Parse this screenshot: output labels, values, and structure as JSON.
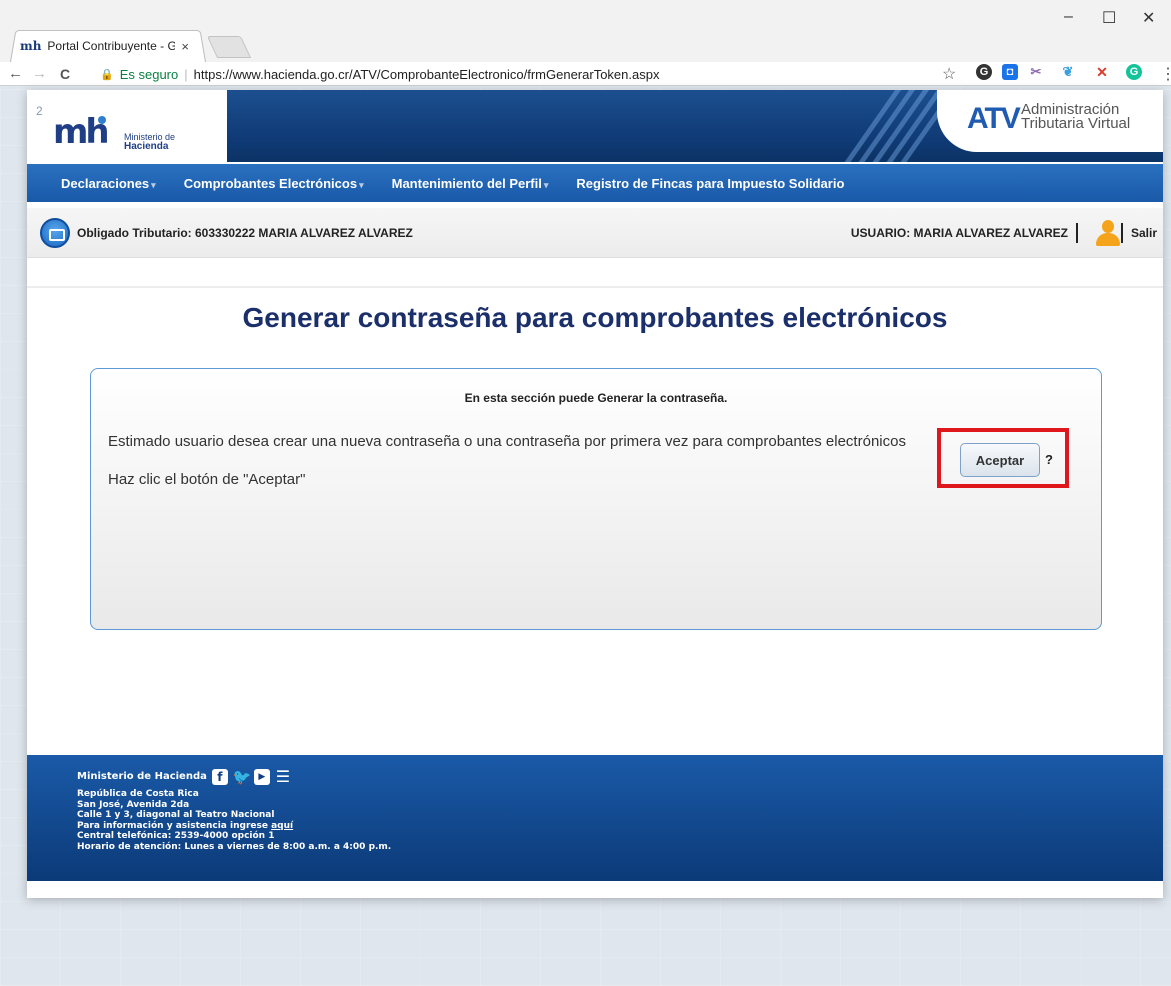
{
  "browser": {
    "tab_favicon": "mh",
    "tab_title": "Portal Contribuyente - Gi",
    "tab_close": "×",
    "secure_label": "Es seguro",
    "url": "https://www.hacienda.go.cr/ATV/ComprobanteElectronico/frmGenerarToken.aspx",
    "window_controls": {
      "minimize": "–",
      "maximize": "☐",
      "close": "✕"
    },
    "nav": {
      "back": "←",
      "forward": "→",
      "reload": "C"
    },
    "star": "☆",
    "more": "⋮",
    "extensions": [
      {
        "icon": "extension-g-icon",
        "glyph": "G",
        "color": "#333333"
      },
      {
        "icon": "extension-square-icon",
        "glyph": "◘",
        "color": "#1a73e8"
      },
      {
        "icon": "extension-scissors-icon",
        "glyph": "✂",
        "color": "#8c6bb1"
      },
      {
        "icon": "extension-leaf-icon",
        "glyph": "❦",
        "color": "#3aa0e0"
      },
      {
        "icon": "extension-x-icon",
        "glyph": "✕",
        "color": "#d93b2b"
      },
      {
        "icon": "extension-grammarly-icon",
        "glyph": "G",
        "color": "#15c39a"
      }
    ]
  },
  "header": {
    "corner_number": "2",
    "logo_mh": "mh",
    "logo_ministerio": "Ministerio de",
    "logo_hacienda": "Hacienda",
    "atv_logo": "ATV",
    "atv_line1": "Administración",
    "atv_line2": "Tributaria Virtual",
    "brand_color": "#0f3a75"
  },
  "navbar": {
    "items": [
      {
        "label": "Declaraciones",
        "caret": "▾"
      },
      {
        "label": "Comprobantes Electrónicos",
        "caret": "▾"
      },
      {
        "label": "Mantenimiento del Perfil",
        "caret": "▾"
      },
      {
        "label": "Registro de Fincas para Impuesto Solidario",
        "caret": ""
      }
    ]
  },
  "infobar": {
    "obligado": "Obligado Tributario: 603330222 MARIA ALVAREZ ALVAREZ",
    "usuario": "USUARIO: MARIA ALVAREZ ALVAREZ",
    "salir": "Salir"
  },
  "main": {
    "title": "Generar contraseña para comprobantes electrónicos",
    "panel": {
      "heading": "En esta sección puede Generar la contraseña.",
      "line1": "Estimado usuario desea crear una nueva contraseña o una contraseña por primera vez para comprobantes electrónicos",
      "line2": "Haz clic el botón de \"Aceptar\"",
      "accept_label": "Aceptar",
      "help_label": "?",
      "highlight_color": "#e0161d"
    }
  },
  "footer": {
    "ministry": "Ministerio de Hacienda",
    "social": {
      "facebook": "f",
      "twitter": "🐦",
      "youtube": "▶",
      "list": "☰"
    },
    "lines": [
      "República de Costa Rica",
      "San José, Avenida 2da",
      "Calle 1 y 3, diagonal al Teatro Nacional"
    ],
    "info_prefix": "Para información y asistencia ingrese ",
    "info_link": "aquí",
    "phone": "Central telefónica: 2539-4000 opción 1",
    "hours": "Horario de atención: Lunes a viernes de 8:00 a.m. a 4:00 p.m."
  }
}
